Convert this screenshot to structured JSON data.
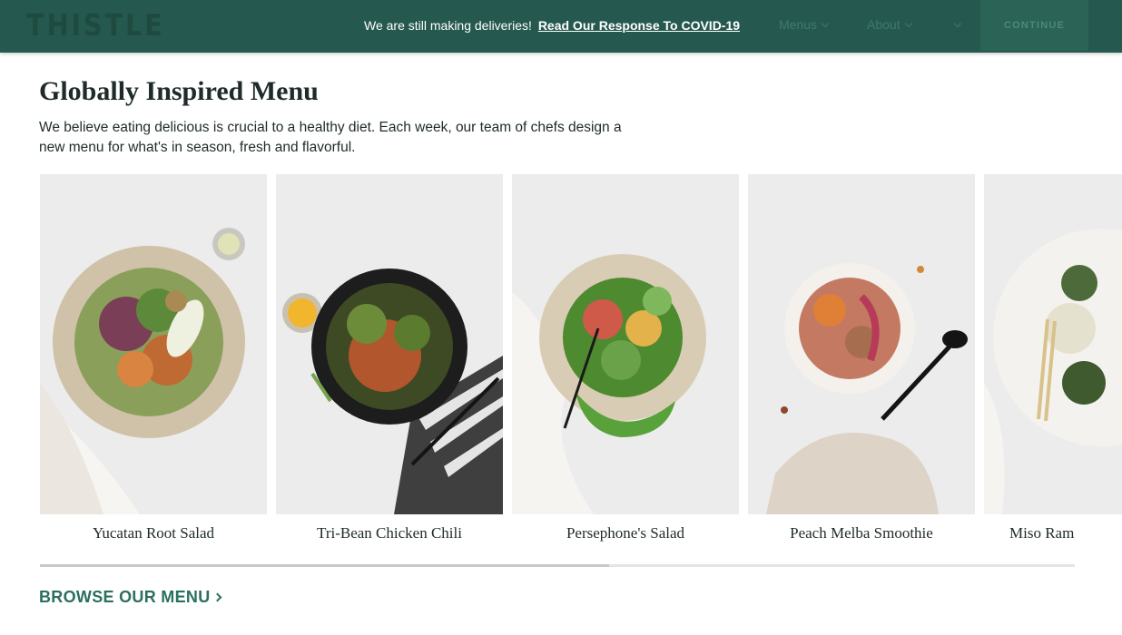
{
  "header": {
    "logo_text": "THISTLE",
    "announcement_text": "We are still making deliveries!",
    "announcement_link": "Read Our Response To COVID-19",
    "nav": [
      {
        "label": "Menus"
      },
      {
        "label": "About"
      }
    ],
    "cta_label": "CONTINUE"
  },
  "main": {
    "title": "Globally Inspired Menu",
    "intro": "We believe eating delicious is crucial to a healthy diet. Each week, our team of chefs design a new menu for what's in season, fresh and flavorful.",
    "cards": [
      {
        "name": "Yucatan Root Salad"
      },
      {
        "name": "Tri-Bean Chicken Chili"
      },
      {
        "name": "Persephone's Salad"
      },
      {
        "name": "Peach Melba Smoothie"
      },
      {
        "name": "Miso Ram"
      }
    ],
    "carousel_scroll_fraction": 0.55,
    "browse_label": "BROWSE OUR MENU"
  },
  "colors": {
    "nav_bg": "#25594f",
    "accent": "#2b6f5f",
    "photo_bg": "#ececec"
  }
}
